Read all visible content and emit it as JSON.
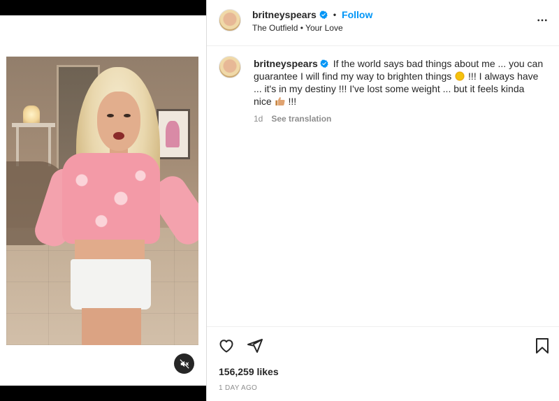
{
  "post": {
    "username": "britneyspears",
    "follow_label": "Follow",
    "dot": "•",
    "audio_artist": "The Outfield",
    "audio_track": "Your Love",
    "more_label": "•••"
  },
  "caption": {
    "username": "britneyspears",
    "text_part1": "If the world says bad things about me ... you can guarantee I will find my way to brighten things",
    "text_part2": "!!! I always have ... it's in my destiny !!! I've lost some weight ... but it feels kinda nice",
    "text_part3": "!!!",
    "time": "1d",
    "see_translation": "See translation"
  },
  "engagement": {
    "likes": "156,259 likes",
    "posted": "1 DAY AGO"
  },
  "icons": {
    "verified": "verified-badge-icon",
    "like": "heart-icon",
    "share": "paper-plane-icon",
    "save": "bookmark-icon",
    "mute": "speaker-muted-icon",
    "more": "more-options-icon"
  },
  "colors": {
    "accent": "#0095f6",
    "text": "#262626",
    "muted": "#8e8e8e"
  }
}
